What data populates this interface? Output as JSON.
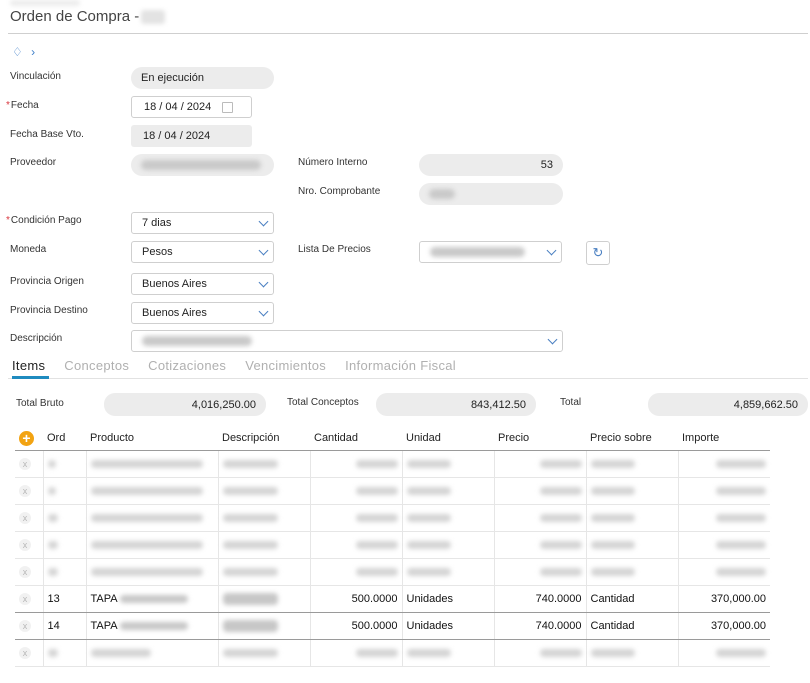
{
  "header": {
    "title": "Orden de Compra -"
  },
  "form": {
    "vinculacion": {
      "label": "Vinculación",
      "value": "En ejecución"
    },
    "fecha": {
      "label": "Fecha",
      "value": "18 / 04 / 2024"
    },
    "fecha_base": {
      "label": "Fecha Base Vto.",
      "value": "18 / 04 / 2024"
    },
    "proveedor": {
      "label": "Proveedor"
    },
    "numero_interno": {
      "label": "Número Interno",
      "value": "53"
    },
    "nro_comprobante": {
      "label": "Nro. Comprobante"
    },
    "condicion_pago": {
      "label": "Condición Pago",
      "value": "7 dias"
    },
    "moneda": {
      "label": "Moneda",
      "value": "Pesos"
    },
    "lista_precios": {
      "label": "Lista De Precios"
    },
    "provincia_origen": {
      "label": "Provincia Origen",
      "value": "Buenos Aires"
    },
    "provincia_destino": {
      "label": "Provincia Destino",
      "value": "Buenos Aires"
    },
    "descripcion": {
      "label": "Descripción"
    }
  },
  "tabs": [
    "Items",
    "Conceptos",
    "Cotizaciones",
    "Vencimientos",
    "Información Fiscal"
  ],
  "totals": {
    "bruto_label": "Total Bruto",
    "bruto": "4,016,250.00",
    "conceptos_label": "Total Conceptos",
    "conceptos": "843,412.50",
    "total_label": "Total",
    "total": "4,859,662.50"
  },
  "table": {
    "headers": [
      "Ord",
      "Producto",
      "Descripción",
      "Cantidad",
      "Unidad",
      "Precio",
      "Precio sobre",
      "Importe"
    ],
    "rows": [
      {
        "ord": "13",
        "producto": "TAPA",
        "cantidad": "500.0000",
        "unidad": "Unidades",
        "precio": "740.0000",
        "precio_sobre": "Cantidad",
        "importe": "370,000.00"
      },
      {
        "ord": "14",
        "producto": "TAPA",
        "cantidad": "500.0000",
        "unidad": "Unidades",
        "precio": "740.0000",
        "precio_sobre": "Cantidad",
        "importe": "370,000.00"
      }
    ],
    "remove_icon": "close-icon",
    "add_icon": "plus-icon"
  }
}
